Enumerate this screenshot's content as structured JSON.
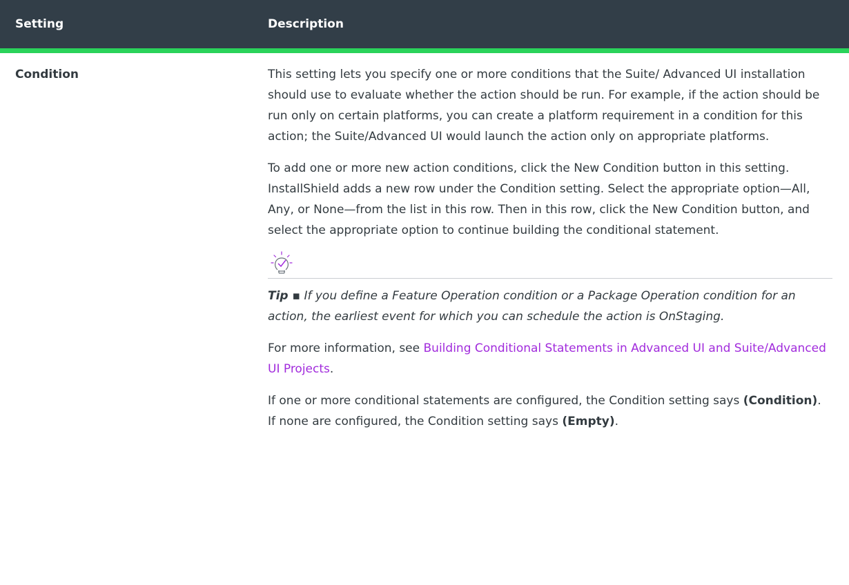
{
  "table": {
    "headers": {
      "setting": "Setting",
      "description": "Description"
    },
    "row": {
      "setting": "Condition",
      "para1": "This setting lets you specify one or more conditions that the Suite/ Advanced UI installation should use to evaluate whether the action should be run. For example, if the action should be run only on certain platforms, you can create a platform requirement in a condition for this action; the Suite/Advanced UI would launch the action only on appropriate platforms.",
      "para2": "To add one or more new action conditions, click the New Condition button in this setting. InstallShield adds a new row under the Condition setting. Select the appropriate option—All, Any, or None—from the list in this row. Then in this row, click the New Condition button, and select the appropriate option to continue building the conditional statement.",
      "tip": {
        "icon": "lightbulb-check-icon",
        "label": "Tip ▪",
        "text": " If you define a Feature Operation condition or a Package Operation condition for an action, the earliest event for which you can schedule the action is OnStaging."
      },
      "more_info": {
        "prefix": "For more information, see ",
        "link_text": "Building Conditional Statements in Advanced UI and Suite/Advanced UI Projects",
        "suffix": "."
      },
      "last": {
        "part1": "If one or more conditional statements are configured, the Condition setting says ",
        "bold1": "(Condition)",
        "part2": ". If none are configured, the Condition setting says ",
        "bold2": "(Empty)",
        "part3": "."
      }
    }
  },
  "colors": {
    "header_bg": "#323e48",
    "header_rule": "#2ad35a",
    "link": "#a12bdc",
    "tip_icon": "#a12bdc"
  }
}
